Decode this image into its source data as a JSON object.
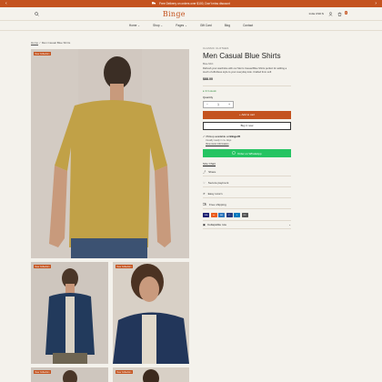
{
  "announcement": {
    "text": "Free Delivery on orders over $100, Don't miss discount"
  },
  "header": {
    "logo": "Binge",
    "currency": "India USD $",
    "cart_count": "0"
  },
  "nav": [
    {
      "label": "Home",
      "dropdown": true
    },
    {
      "label": "Shop",
      "dropdown": true
    },
    {
      "label": "Pages",
      "dropdown": true
    },
    {
      "label": "Gift Card",
      "dropdown": false
    },
    {
      "label": "Blog",
      "dropdown": false
    },
    {
      "label": "Contact",
      "dropdown": false
    }
  ],
  "breadcrumb": {
    "home": "Home",
    "sep": "/",
    "current": "Men Casual Blue Shirts"
  },
  "badges": {
    "new_collection": "New Collection"
  },
  "product": {
    "vendor": "CLASSIC CLOTHES",
    "title": "Men Casual Blue Shirts",
    "sku": "Blue-Shirt",
    "description": "Refresh your wardrobe with our Men's Casual Blue Shirts perfect for adding a touch of effortless style to your everyday look. Crafted from soft",
    "price": "$88.00",
    "stock": "9 In stock",
    "quantity_label": "Quantity",
    "quantity_value": "1",
    "add_to_cart": "Add to cart",
    "buy_now": "Buy it now",
    "pickup_prefix": "Pickup available at",
    "pickup_store": "Binge45",
    "ready_text": "Usually ready in 4+ days",
    "store_info": "View store information",
    "whatsapp": "Order on WhatsApp",
    "size_chart": "Size Chart",
    "features": [
      "Share",
      "Secure payment",
      "Easy return",
      "Free shipping"
    ],
    "collapsible": "Collapsible row"
  },
  "payment_methods": [
    {
      "name": "visa",
      "color": "#1a1f71"
    },
    {
      "name": "mastercard",
      "color": "#eb5d1e"
    },
    {
      "name": "amex",
      "color": "#2e77bc"
    },
    {
      "name": "paypal",
      "color": "#253b80"
    },
    {
      "name": "diners",
      "color": "#0079be"
    },
    {
      "name": "discover",
      "color": "#555555"
    }
  ],
  "colors": {
    "accent": "#c4531f",
    "background": "#f4f2ec",
    "whatsapp": "#25c462",
    "stock": "#2f8a3a"
  }
}
